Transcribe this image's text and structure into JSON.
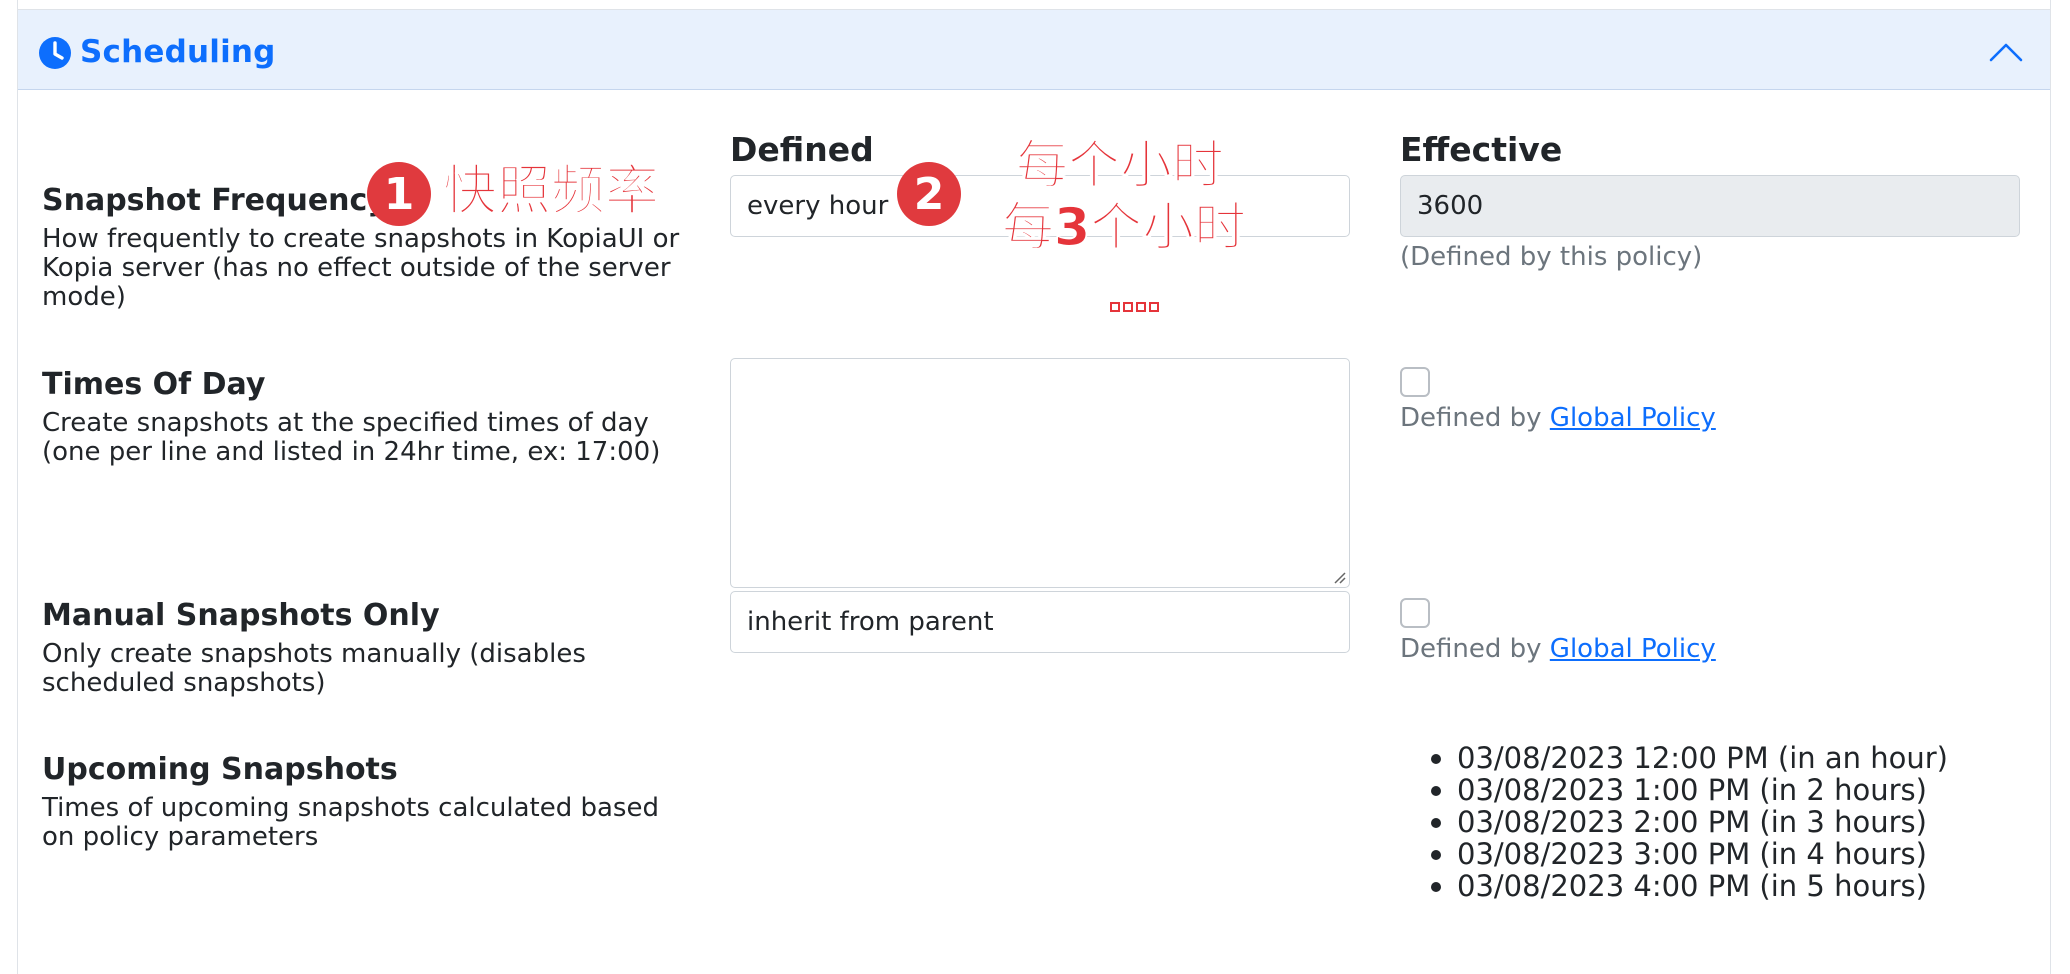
{
  "section": {
    "title": "Scheduling",
    "icon": "clock-icon",
    "collapse_icon": "chevron-up-icon"
  },
  "columns": {
    "defined": "Defined",
    "effective": "Effective"
  },
  "rows": {
    "snapshot_frequency": {
      "title": "Snapshot Frequency",
      "description": "How frequently to create snapshots in KopiaUI or Kopia server (has no effect outside of the server mode)",
      "defined_value": "every hour",
      "effective_value": "3600",
      "effective_note": "(Defined by this policy)"
    },
    "times_of_day": {
      "title": "Times Of Day",
      "description": "Create snapshots at the specified times of day (one per line and listed in 24hr time, ex: 17:00)",
      "defined_value": "",
      "effective_prefix": "Defined by ",
      "effective_link": "Global Policy"
    },
    "manual_only": {
      "title": "Manual Snapshots Only",
      "description": "Only create snapshots manually (disables scheduled snapshots)",
      "defined_value": "inherit from parent",
      "effective_prefix": "Defined by ",
      "effective_link": "Global Policy"
    },
    "upcoming": {
      "title": "Upcoming Snapshots",
      "description": "Times of upcoming snapshots calculated based on policy parameters",
      "items": [
        "03/08/2023 12:00 PM (in an hour)",
        "03/08/2023 1:00 PM (in 2 hours)",
        "03/08/2023 2:00 PM (in 3 hours)",
        "03/08/2023 3:00 PM (in 4 hours)",
        "03/08/2023 4:00 PM (in 5 hours)"
      ]
    }
  },
  "annotations": {
    "badge1": "1",
    "label1": "快照频率",
    "badge2": "2",
    "line1": "每个小时",
    "line2": "每3个小时",
    "accent": "#e03a3e"
  },
  "colors": {
    "header_bg": "#e8f1fd",
    "accent": "#0d6efd",
    "muted": "#6c757d"
  }
}
